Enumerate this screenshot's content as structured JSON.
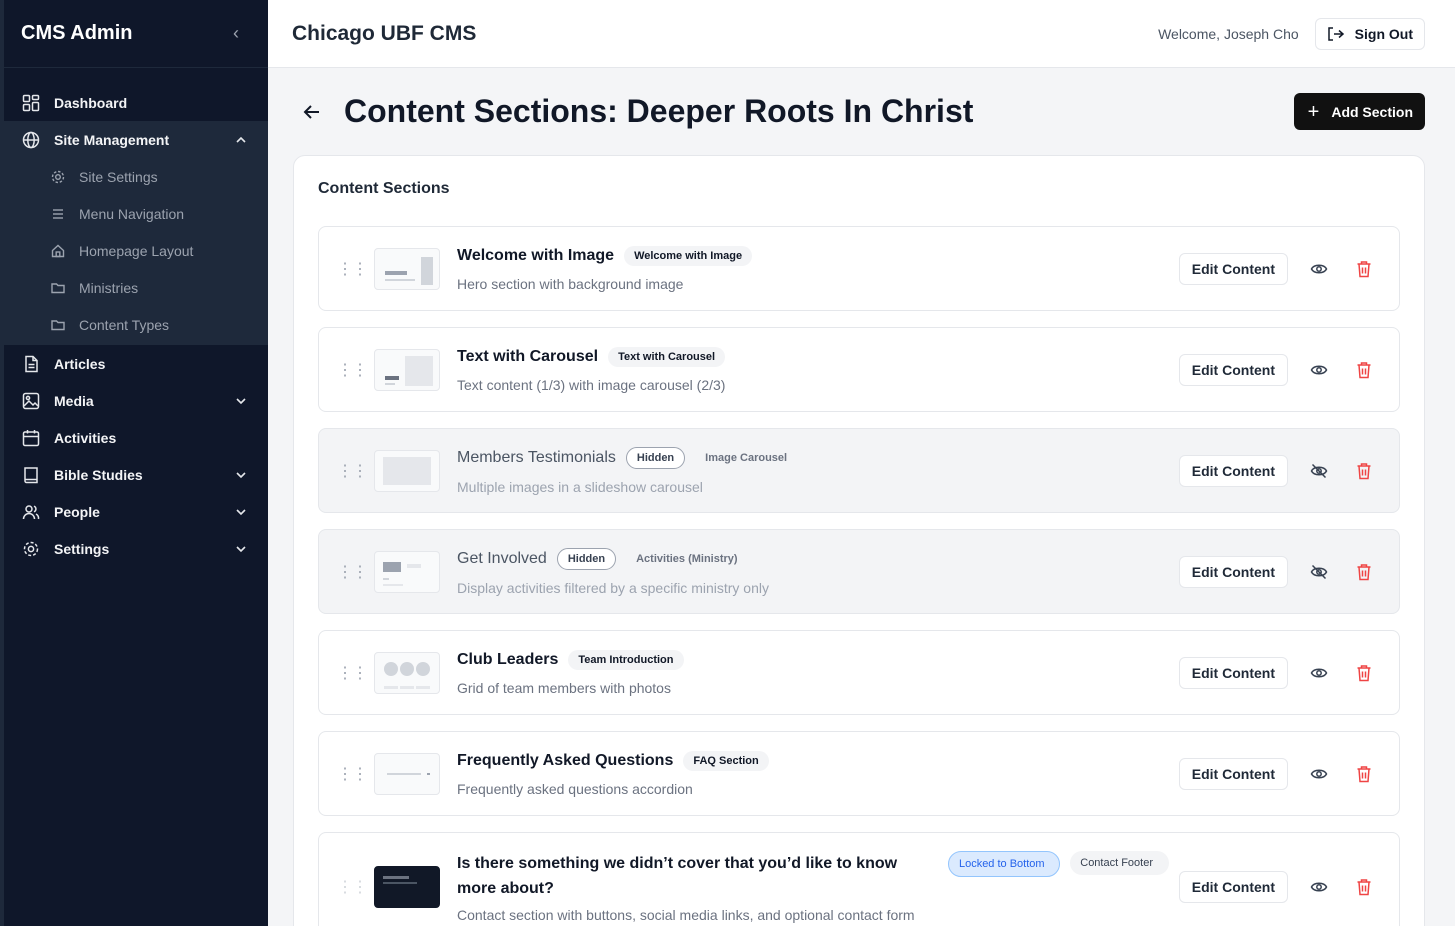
{
  "sidebar": {
    "title": "CMS Admin",
    "items": [
      {
        "label": "Dashboard",
        "icon": "dashboard-icon"
      },
      {
        "label": "Site Management",
        "icon": "globe-icon"
      },
      {
        "label": "Articles",
        "icon": "file-icon"
      },
      {
        "label": "Media",
        "icon": "image-icon"
      },
      {
        "label": "Activities",
        "icon": "calendar-icon"
      },
      {
        "label": "Bible Studies",
        "icon": "book-icon"
      },
      {
        "label": "People",
        "icon": "users-icon"
      },
      {
        "label": "Settings",
        "icon": "gear-icon"
      }
    ],
    "sub_items": [
      {
        "label": "Site Settings",
        "icon": "gear-icon"
      },
      {
        "label": "Menu Navigation",
        "icon": "menu-icon"
      },
      {
        "label": "Homepage Layout",
        "icon": "home-icon"
      },
      {
        "label": "Ministries",
        "icon": "folder-icon"
      },
      {
        "label": "Content Types",
        "icon": "folder-icon"
      }
    ]
  },
  "header": {
    "app_title": "Chicago UBF CMS",
    "welcome": "Welcome, Joseph Cho",
    "sign_out": "Sign Out"
  },
  "page": {
    "title": "Content Sections: Deeper Roots In Christ",
    "add_button": "Add Section",
    "card_title": "Content Sections"
  },
  "sections": [
    {
      "title": "Welcome with Image",
      "type": "Welcome with Image",
      "desc": "Hero section with background image",
      "hidden": false
    },
    {
      "title": "Text with Carousel",
      "type": "Text with Carousel",
      "desc": "Text content (1/3) with image carousel (2/3)",
      "hidden": false
    },
    {
      "title": "Members Testimonials",
      "status": "Hidden",
      "type": "Image Carousel",
      "desc": "Multiple images in a slideshow carousel",
      "hidden": true
    },
    {
      "title": "Get Involved",
      "status": "Hidden",
      "type": "Activities (Ministry)",
      "desc": "Display activities filtered by a specific ministry only",
      "hidden": true
    },
    {
      "title": "Club Leaders",
      "type": "Team Introduction",
      "desc": "Grid of team members with photos",
      "hidden": false
    },
    {
      "title": "Frequently Asked Questions",
      "type": "FAQ Section",
      "desc": "Frequently asked questions accordion",
      "hidden": false
    },
    {
      "title": "Is there something we didn’t cover that you’d like to know more about?",
      "lock": "Locked to Bottom",
      "type": "Contact Footer",
      "desc": "Contact section with buttons, social media links, and optional contact form",
      "hidden": false
    }
  ],
  "edit_label": "Edit Content",
  "colors": {
    "sidebar": "#0f172a",
    "accent_dark": "#111111",
    "danger": "#ef4444",
    "lock_blue": "#2563eb"
  }
}
